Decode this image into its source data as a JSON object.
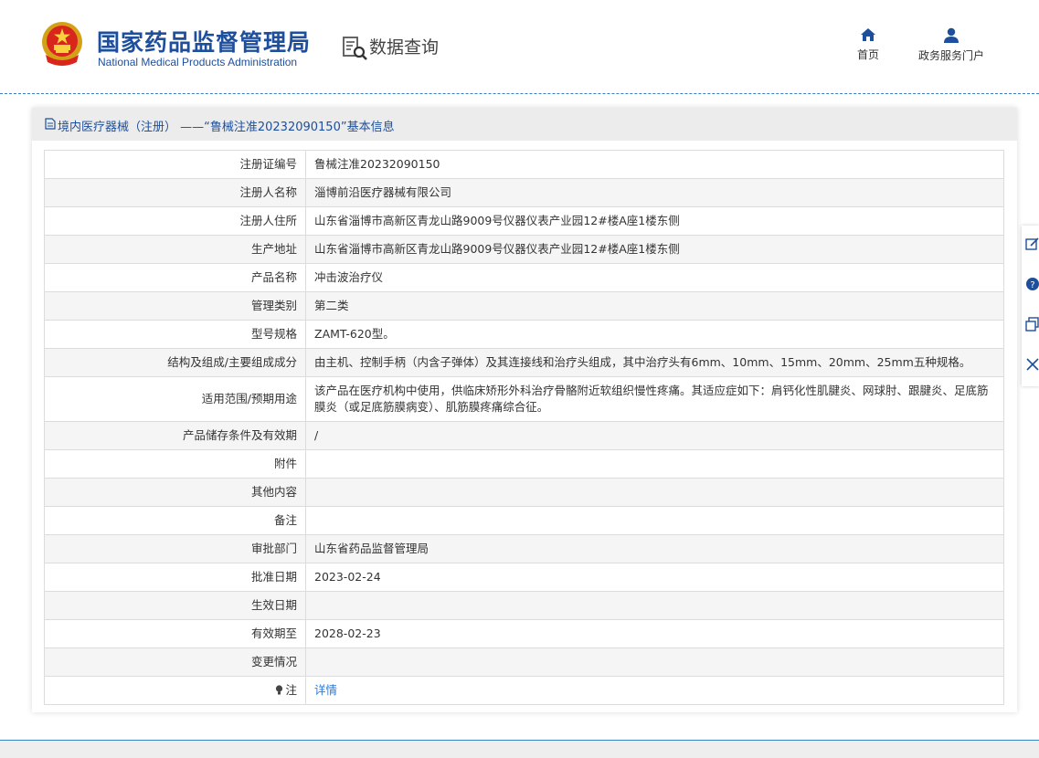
{
  "header": {
    "logo_cn": "国家药品监督管理局",
    "logo_en": "National Medical Products Administration",
    "query_title": "数据查询",
    "nav": [
      {
        "label": "首页",
        "icon": "home-icon"
      },
      {
        "label": "政务服务门户",
        "icon": "user-icon"
      }
    ]
  },
  "card": {
    "title": "境内医疗器械（注册） ——“鲁械注准20232090150”基本信息"
  },
  "rows": [
    {
      "label": "注册证编号",
      "value": "鲁械注准20232090150"
    },
    {
      "label": "注册人名称",
      "value": "淄博前沿医疗器械有限公司"
    },
    {
      "label": "注册人住所",
      "value": "山东省淄博市高新区青龙山路9009号仪器仪表产业园12#楼A座1楼东侧"
    },
    {
      "label": "生产地址",
      "value": "山东省淄博市高新区青龙山路9009号仪器仪表产业园12#楼A座1楼东侧"
    },
    {
      "label": "产品名称",
      "value": "冲击波治疗仪"
    },
    {
      "label": "管理类别",
      "value": "第二类"
    },
    {
      "label": "型号规格",
      "value": "ZAMT-620型。"
    },
    {
      "label": "结构及组成/主要组成成分",
      "value": "由主机、控制手柄（内含子弹体）及其连接线和治疗头组成，其中治疗头有6mm、10mm、15mm、20mm、25mm五种规格。"
    },
    {
      "label": "适用范围/预期用途",
      "value": "该产品在医疗机构中使用，供临床矫形外科治疗骨骼附近软组织慢性疼痛。其适应症如下：肩钙化性肌腱炎、网球肘、跟腱炎、足底筋膜炎（或足底筋膜病变）、肌筋膜疼痛综合征。"
    },
    {
      "label": "产品储存条件及有效期",
      "value": "/"
    },
    {
      "label": "附件",
      "value": ""
    },
    {
      "label": "其他内容",
      "value": ""
    },
    {
      "label": "备注",
      "value": ""
    },
    {
      "label": "审批部门",
      "value": "山东省药品监督管理局"
    },
    {
      "label": "批准日期",
      "value": "2023-02-24"
    },
    {
      "label": "生效日期",
      "value": ""
    },
    {
      "label": "有效期至",
      "value": "2028-02-23"
    },
    {
      "label": "变更情况",
      "value": ""
    },
    {
      "label": "注",
      "value": "详情"
    }
  ],
  "colors": {
    "brand_blue": "#1e4f9c",
    "link_blue": "#2a7ad6",
    "title_bar": "#ececec"
  }
}
